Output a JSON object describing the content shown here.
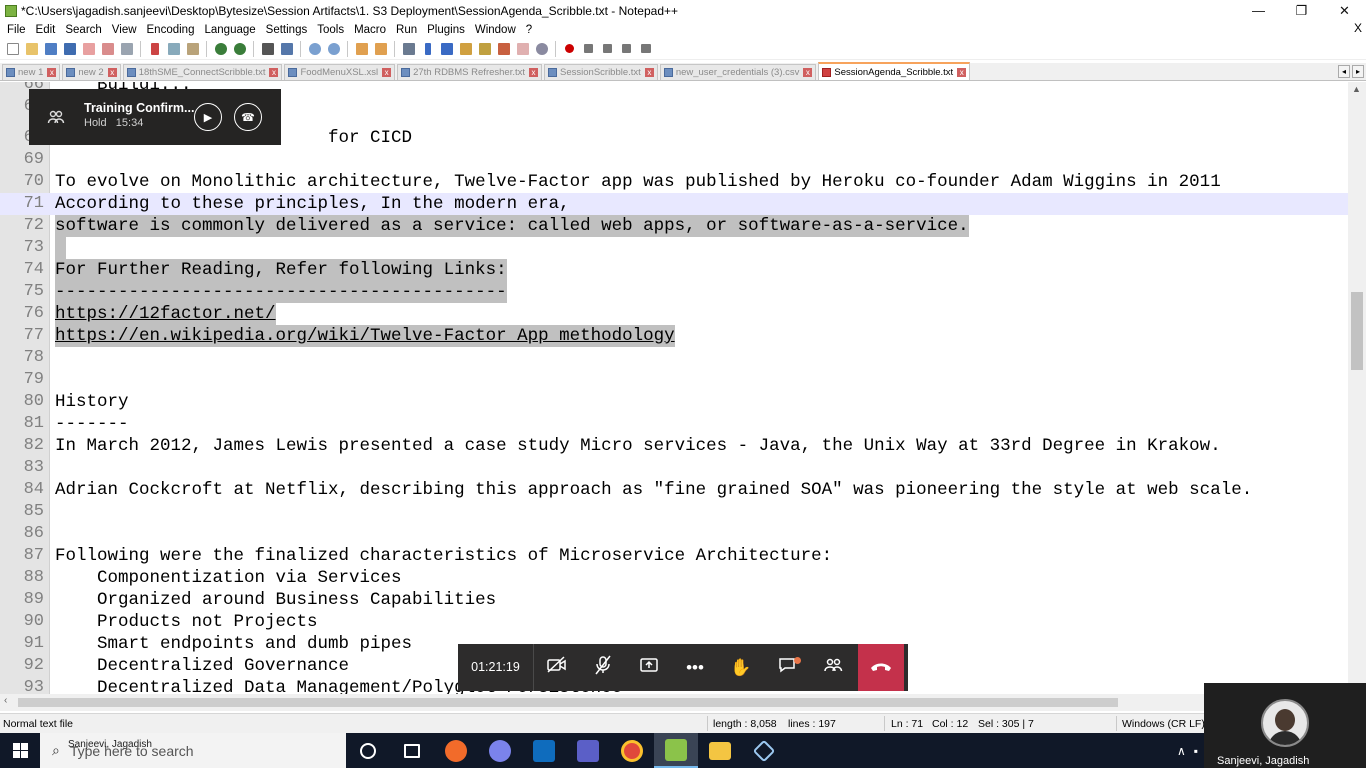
{
  "window": {
    "title": "*C:\\Users\\jagadish.sanjeevi\\Desktop\\Bytesize\\Session Artifacts\\1. S3 Deployment\\SessionAgenda_Scribble.txt - Notepad++",
    "minimize": "—",
    "maximize": "❐",
    "close": "✕"
  },
  "menu": [
    "File",
    "Edit",
    "Search",
    "View",
    "Encoding",
    "Language",
    "Settings",
    "Tools",
    "Macro",
    "Run",
    "Plugins",
    "Window",
    "?"
  ],
  "menu_close": "X",
  "toolbar_icons": [
    "new-file-icon",
    "open-file-icon",
    "save-icon",
    "save-all-icon",
    "close-icon",
    "close-all-icon",
    "print-icon",
    "cut-icon",
    "copy-icon",
    "paste-icon",
    "undo-icon",
    "redo-icon",
    "find-icon",
    "replace-icon",
    "zoom-in-icon",
    "zoom-out-icon",
    "sync-v-icon",
    "sync-h-icon",
    "wrap-icon",
    "all-chars-icon",
    "indent-guide-icon",
    "udl-icon",
    "doc-map-icon",
    "function-list-icon",
    "folder-workspace-icon",
    "monitor-icon",
    "record-macro-icon",
    "stop-macro-icon",
    "play-macro-icon",
    "run-macro-icon",
    "save-macro-icon"
  ],
  "tabs": [
    {
      "label": "new 1",
      "active": false
    },
    {
      "label": "new 2",
      "active": false
    },
    {
      "label": "18thSME_ConnectScribble.txt",
      "active": false
    },
    {
      "label": "FoodMenuXSL.xsl",
      "active": false
    },
    {
      "label": "27th RDBMS Refresher.txt",
      "active": false
    },
    {
      "label": "SessionScribble.txt",
      "active": false
    },
    {
      "label": "new_user_credentials (3).csv",
      "active": false
    },
    {
      "label": "SessionAgenda_Scribble.txt",
      "active": true
    }
  ],
  "tab_scroll": {
    "left": "◂",
    "right": "▸"
  },
  "editor": {
    "lines": [
      {
        "num": "66",
        "text": "    Buildi..."
      },
      {
        "num": "67",
        "text": ""
      },
      {
        "num": "68",
        "text": "                          for CICD"
      },
      {
        "num": "69",
        "text": ""
      },
      {
        "num": "70",
        "text": "To evolve on Monolithic architecture, Twelve-Factor app was published by Heroku co-founder Adam Wiggins in 2011"
      },
      {
        "num": "71",
        "text": "According to these principles, In the modern era,"
      },
      {
        "num": "72",
        "text": "software is commonly delivered as a service: called web apps, or software-as-a-service."
      },
      {
        "num": "73",
        "text": " "
      },
      {
        "num": "74",
        "text": "For Further Reading, Refer following Links:"
      },
      {
        "num": "75",
        "text": "-------------------------------------------"
      },
      {
        "num": "76",
        "text": "https://12factor.net/"
      },
      {
        "num": "77",
        "text": "https://en.wikipedia.org/wiki/Twelve-Factor_App_methodology"
      },
      {
        "num": "78",
        "text": ""
      },
      {
        "num": "79",
        "text": ""
      },
      {
        "num": "80",
        "text": "History"
      },
      {
        "num": "81",
        "text": "-------"
      },
      {
        "num": "82",
        "text": "In March 2012, James Lewis presented a case study Micro services - Java, the Unix Way at 33rd Degree in Krakow."
      },
      {
        "num": "83",
        "text": ""
      },
      {
        "num": "84",
        "text": "Adrian Cockcroft at Netflix, describing this approach as \"fine grained SOA\" was pioneering the style at web scale."
      },
      {
        "num": "85",
        "text": ""
      },
      {
        "num": "86",
        "text": ""
      },
      {
        "num": "87",
        "text": "Following were the finalized characteristics of Microservice Architecture:"
      },
      {
        "num": "88",
        "text": "    Componentization via Services"
      },
      {
        "num": "89",
        "text": "    Organized around Business Capabilities"
      },
      {
        "num": "90",
        "text": "    Products not Projects"
      },
      {
        "num": "91",
        "text": "    Smart endpoints and dumb pipes"
      },
      {
        "num": "92",
        "text": "    Decentralized Governance"
      },
      {
        "num": "93",
        "text": "    Decentralized Data Management/Polyglot Persistence"
      }
    ]
  },
  "statusbar": {
    "file_type": "Normal text file",
    "length": "length : 8,058",
    "lines": "lines : 197",
    "ln": "Ln : 71",
    "col": "Col : 12",
    "sel": "Sel : 305 | 7",
    "eol": "Windows (CR LF)"
  },
  "hold_toast": {
    "title": "Training Confirm...",
    "status": "Hold",
    "time": "15:34"
  },
  "callbar": {
    "timer": "01:21:19"
  },
  "taskbar": {
    "search_placeholder": "Type here to search",
    "overlay_name": "Sanjeevi, Jagadish"
  },
  "self_video": {
    "name": "Sanjeevi, Jagadish"
  },
  "colors": {
    "selection": "#c0c0c0",
    "current_line": "#e8e8ff",
    "active_tab_accent": "#f7a35c",
    "leave_call": "#c4314b",
    "taskbar_bg": "#101828"
  }
}
